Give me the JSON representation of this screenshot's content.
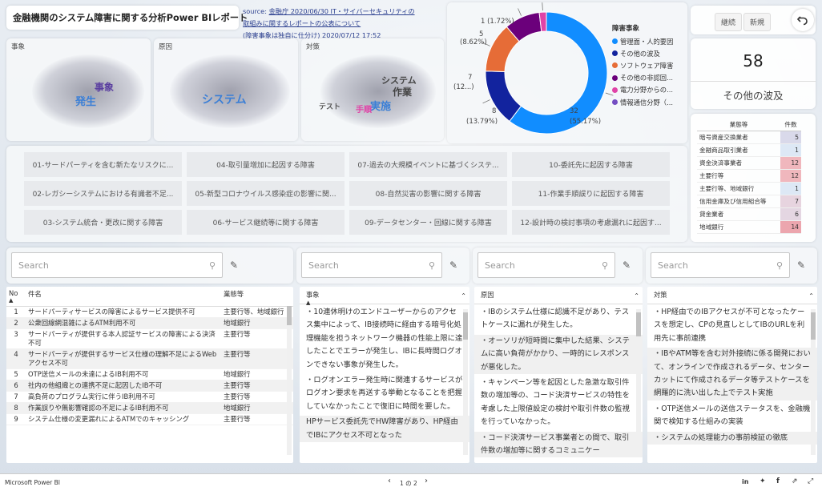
{
  "report_title": "金融機関のシステム障害に関する分析Power BIレポート",
  "source": {
    "prefix": "source: ",
    "link_text_1": "金融庁 2020/06/30 IT・サイバーセキュリティの",
    "link_text_2": "取組みに関するレポートの公表について",
    "note": "(障害事象は独自に仕分け) 2020/07/12 17:52"
  },
  "wordclouds": [
    {
      "label": "事象",
      "words": [
        "事象",
        "発生"
      ]
    },
    {
      "label": "原因",
      "words": [
        "システム"
      ]
    },
    {
      "label": "対策",
      "words": [
        "システム",
        "作業",
        "実施",
        "テスト",
        "手順"
      ]
    }
  ],
  "donut": {
    "labels": [
      "1 (1.72%)",
      "5",
      "(8.62%)",
      "7",
      "(12...)",
      "8",
      "(13.79%)",
      "32",
      "(55.17%)"
    ],
    "legend_title": "障害事象",
    "legend": [
      {
        "label": "管理面・人的要因",
        "color": "#118dff"
      },
      {
        "label": "その他の波及",
        "color": "#12239e"
      },
      {
        "label": "ソフトウェア障害",
        "color": "#e66c37"
      },
      {
        "label": "その他の非認回...",
        "color": "#6b007b"
      },
      {
        "label": "電力分野からの...",
        "color": "#e044a7"
      },
      {
        "label": "情報通信分野（...",
        "color": "#744ec2"
      }
    ]
  },
  "chart_data": {
    "type": "pie",
    "categories": [
      "管理面・人的要因",
      "その他の波及",
      "ソフトウェア障害",
      "その他の非認回...",
      "電力分野からの..."
    ],
    "values": [
      32,
      8,
      7,
      5,
      1
    ],
    "percent_labels": [
      "55.17%",
      "13.79%",
      "12...",
      "8.62%",
      "1.72%"
    ],
    "colors": [
      "#118dff",
      "#12239e",
      "#e66c37",
      "#6b007b",
      "#e044a7"
    ],
    "legend_title": "障害事象",
    "legend_position": "right"
  },
  "toggle": {
    "option1": "継続",
    "option2": "新規"
  },
  "kpi": {
    "value": "58",
    "label": "その他の波及"
  },
  "industry_table": {
    "headers": [
      "業態等",
      "件数"
    ],
    "rows": [
      {
        "name": "暗号資産交換業者",
        "count": "5",
        "color": "#d9d9ea"
      },
      {
        "name": "金融商品取引業者",
        "count": "1",
        "color": "#dde8f5"
      },
      {
        "name": "資金決済事業者",
        "count": "12",
        "color": "#f0b7bd"
      },
      {
        "name": "主要行等",
        "count": "12",
        "color": "#f0b7bd"
      },
      {
        "name": "主要行等、地域銀行",
        "count": "1",
        "color": "#dde8f5"
      },
      {
        "name": "信用金庫及び信用組合等",
        "count": "7",
        "color": "#e7d4df"
      },
      {
        "name": "貸金業者",
        "count": "6",
        "color": "#e4d6e2"
      },
      {
        "name": "地域銀行",
        "count": "14",
        "color": "#eca6ae"
      }
    ]
  },
  "topics": [
    [
      "01-サードパーティを含む新たなリスクに...",
      "04-取引量増加に起因する障害",
      "07-過去の大規模イベントに基づくシステ...",
      "10-委託先に起因する障害"
    ],
    [
      "02-レガシーシステムにおける有識者不足...",
      "05-新型コロナウイルス感染症の影響に関...",
      "08-自然災害の影響に関する障害",
      "11-作業手順誤りに起因する障害"
    ],
    [
      "03-システム統合・更改に関する障害",
      "06-サービス継続等に関する障害",
      "09-データセンター・回線に関する障害",
      "12-設計時の検討事項の考慮漏れに起因す..."
    ]
  ],
  "search_placeholder": "Search",
  "main_table": {
    "headers": [
      "No",
      "件名",
      "業態等"
    ],
    "rows": [
      {
        "no": "1",
        "name": "サードパーティサービスの障害によるサービス提供不可",
        "type": "主要行等、地域銀行"
      },
      {
        "no": "2",
        "name": "公衆回線網混雑によるATM利用不可",
        "type": "地域銀行"
      },
      {
        "no": "3",
        "name": "サードパーティが提供する本人認証サービスの障害による決済不可",
        "type": "主要行等"
      },
      {
        "no": "4",
        "name": "サードパーティが提供するサービス仕様の理解不足によるWebアクセス不可",
        "type": "主要行等"
      },
      {
        "no": "5",
        "name": "OTP送信メールの未達によるIB利用不可",
        "type": "地域銀行"
      },
      {
        "no": "6",
        "name": "社内の他組織との連携不足に起因したIB不可",
        "type": "主要行等"
      },
      {
        "no": "7",
        "name": "高負荷のプログラム実行に伴うIB利用不可",
        "type": "主要行等"
      },
      {
        "no": "8",
        "name": "作業誤りや無影響確認の不足によるIB利用不可",
        "type": "地域銀行"
      },
      {
        "no": "9",
        "name": "システム仕様の変更漏れによるATMでのキャッシング",
        "type": "主要行等"
      }
    ]
  },
  "event_list": {
    "header": "事象",
    "items": [
      "・10連休明けのエンドユーザーからのアクセス集中によって、IB接続時に経由する暗号化処理機能を担うネットワーク機器の性能上限に達したことでエラーが発生し、IBに長時間ログオンできない事象が発生した。",
      "・ログオンエラー発生時に関連するサービスがログオン要求を再送する挙動となることを把握していなかったことで復旧に時間を要した。",
      "HPサービス委託先でHW障害があり、HP経由でIBにアクセス不可となった"
    ]
  },
  "cause_list": {
    "header": "原因",
    "items": [
      "・IBのシステム仕様に認識不足があり、テストケースに漏れが発生した。",
      "・オーソリが短時間に集中した結果、システムに高い負荷がかかり、一時的にレスポンスが悪化した。",
      "・キャンペーン等を起因とした急激な取引件数の増加等の、コード決済サービスの特性を考慮した上限値設定の検討や取引件数の監視を行っていなかった。",
      "・コード決済サービス事業者との間で、取引件数の増加等に関するコミュニケー"
    ]
  },
  "measure_list": {
    "header": "対策",
    "items": [
      "・HP経由でのIBアクセスが不可となったケースを想定し、CPの見直しとしてIBのURLを利用先に事前連携",
      "・IBやATM等を含む対外接続に係る開発において、オンラインで作成されるデータ、センターカットにて作成されるデータ等テストケースを網羅的に洗い出した上でテスト実施",
      "・OTP送信メールの送信ステータスを、金融機関で検知する仕組みの実装",
      "・システムの処理能力の事前検証の徹底"
    ]
  },
  "footer": {
    "app": "Microsoft Power BI",
    "page": "1 の 2"
  }
}
